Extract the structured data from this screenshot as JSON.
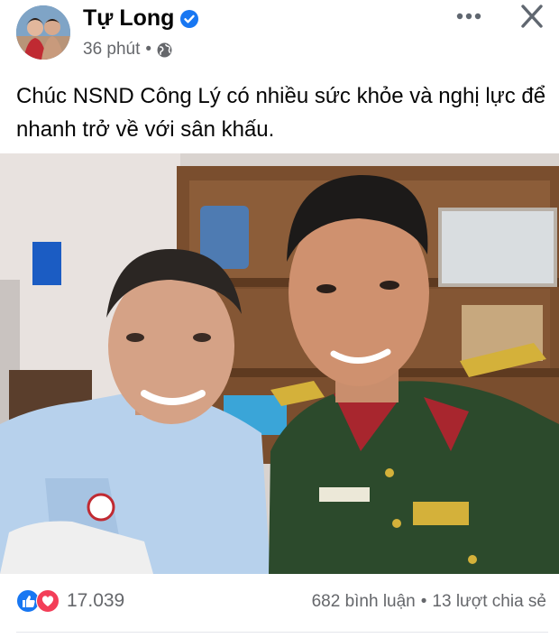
{
  "post": {
    "author": "Tự Long",
    "time": "36 phút",
    "meta_separator": "•",
    "text": "Chúc NSND Công Lý có nhiều sức khỏe và nghị lực để nhanh trở về với sân khấu."
  },
  "icons": {
    "verified": "verified-badge-icon",
    "privacy": "globe-icon",
    "more": "more-dots-icon",
    "close": "close-icon",
    "like": "like-reaction-icon",
    "love": "love-reaction-icon"
  },
  "engagement": {
    "reaction_count": "17.039",
    "comments": "682 bình luận",
    "separator": "•",
    "shares": "13 lượt chia sẻ"
  },
  "colors": {
    "brand_blue": "#1877f2",
    "love_red": "#f33e58",
    "secondary_text": "#65676b",
    "uniform_green": "#2c4a2c"
  }
}
